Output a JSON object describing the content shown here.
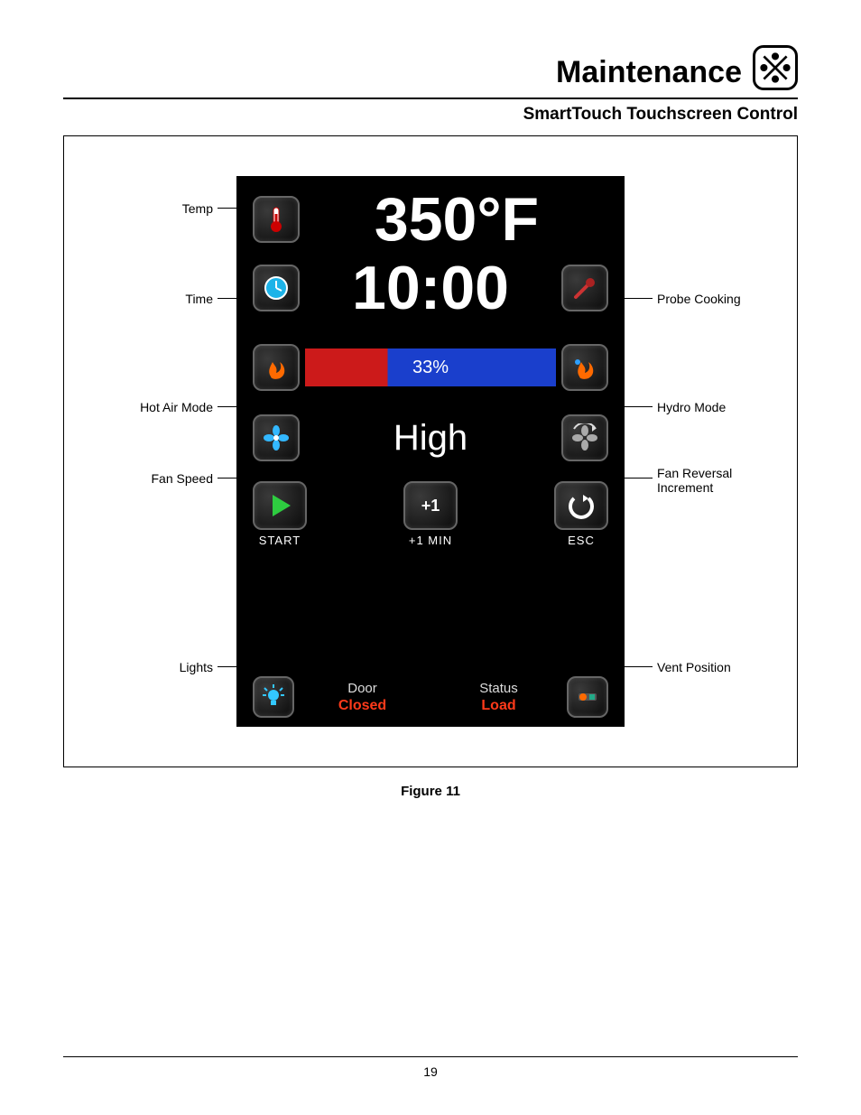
{
  "header": {
    "title": "Maintenance"
  },
  "subtitle": "SmartTouch Touchscreen Control",
  "screen": {
    "temp": "350°F",
    "time": "10:00",
    "mode_pct": "33%",
    "fan": "High",
    "start_label": "START",
    "plus1_label": "+1  MIN",
    "esc_label": "ESC",
    "door_title": "Door",
    "door_val": "Closed",
    "status_title": "Status",
    "status_val": "Load"
  },
  "callouts": {
    "temp": "Temp",
    "time": "Time",
    "hot_air": "Hot Air Mode",
    "fan_speed": "Fan Speed",
    "lights": "Lights",
    "probe": "Probe Cooking",
    "hydro": "Hydro Mode",
    "fan_rev": "Fan Reversal\nIncrement",
    "vent": "Vent Position"
  },
  "figure_caption": "Figure 11",
  "page_number": "19"
}
